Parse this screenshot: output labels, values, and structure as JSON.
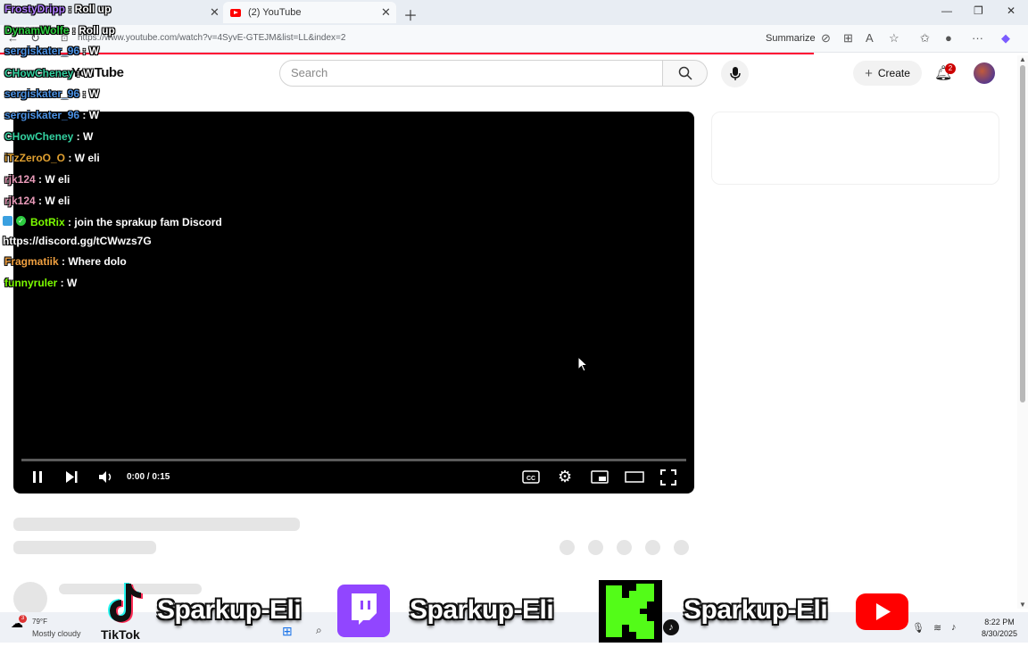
{
  "browser": {
    "tabs": [
      {
        "label": ""
      },
      {
        "label": "(2) YouTube"
      }
    ],
    "url": "https://www.youtube.com/watch?v=4SyvE-GTEJM&list=LL&index=2",
    "summarize_label": "Summarize"
  },
  "youtube": {
    "logo_text": "YouTube",
    "search_placeholder": "Search",
    "create_label": "Create",
    "notification_count": "2"
  },
  "player": {
    "time": "0:00 / 0:15",
    "progress": 0
  },
  "chat": [
    {
      "name": "FrostyDripp",
      "color": "#b07cff",
      "text": ": Roll up"
    },
    {
      "name": "DynamWolfe",
      "color": "#2ecc40",
      "text": ": Roll up"
    },
    {
      "name": "sergiskater_96",
      "color": "#4a90e2",
      "text": ": W"
    },
    {
      "name": "CHowCheney",
      "color": "#33d1a0",
      "text": ": W"
    },
    {
      "name": "sergiskater_96",
      "color": "#4a90e2",
      "text": ": W"
    },
    {
      "name": "sergiskater_96",
      "color": "#4a90e2",
      "text": ": W"
    },
    {
      "name": "CHowCheney",
      "color": "#33d1a0",
      "text": ": W"
    },
    {
      "name": "iTzZeroO_O",
      "color": "#e0a030",
      "text": ": W eli"
    },
    {
      "name": "rjk124",
      "color": "#e89ab8",
      "text": ": W eli"
    },
    {
      "name": "rjk124",
      "color": "#e89ab8",
      "text": ": W eli"
    },
    {
      "name": "BotRix",
      "color": "#7cfc00",
      "text": ": join the sprakup fam Discord"
    },
    {
      "name": "",
      "color": "#ffffff",
      "text": "https://discord.gg/tCWwzs7G"
    },
    {
      "name": "Fragmatiik",
      "color": "#f0a040",
      "text": ": Where dolo"
    },
    {
      "name": "funnyruler",
      "color": "#7cfc00",
      "text": ": W"
    }
  ],
  "branding": {
    "tiktok_label": "TikTok",
    "handle_1": "Sparkup-Eli",
    "handle_2": "Sparkup-Eli",
    "handle_3": "Sparkup-Eli"
  },
  "taskbar": {
    "weather_temp": "79°F",
    "weather_desc": "Mostly cloudy",
    "time": "8:22 PM",
    "date": "8/30/2025"
  },
  "colors": {
    "yt_red": "#ff0000",
    "twitch_purple": "#9146ff",
    "kick_green": "#53fc18"
  }
}
